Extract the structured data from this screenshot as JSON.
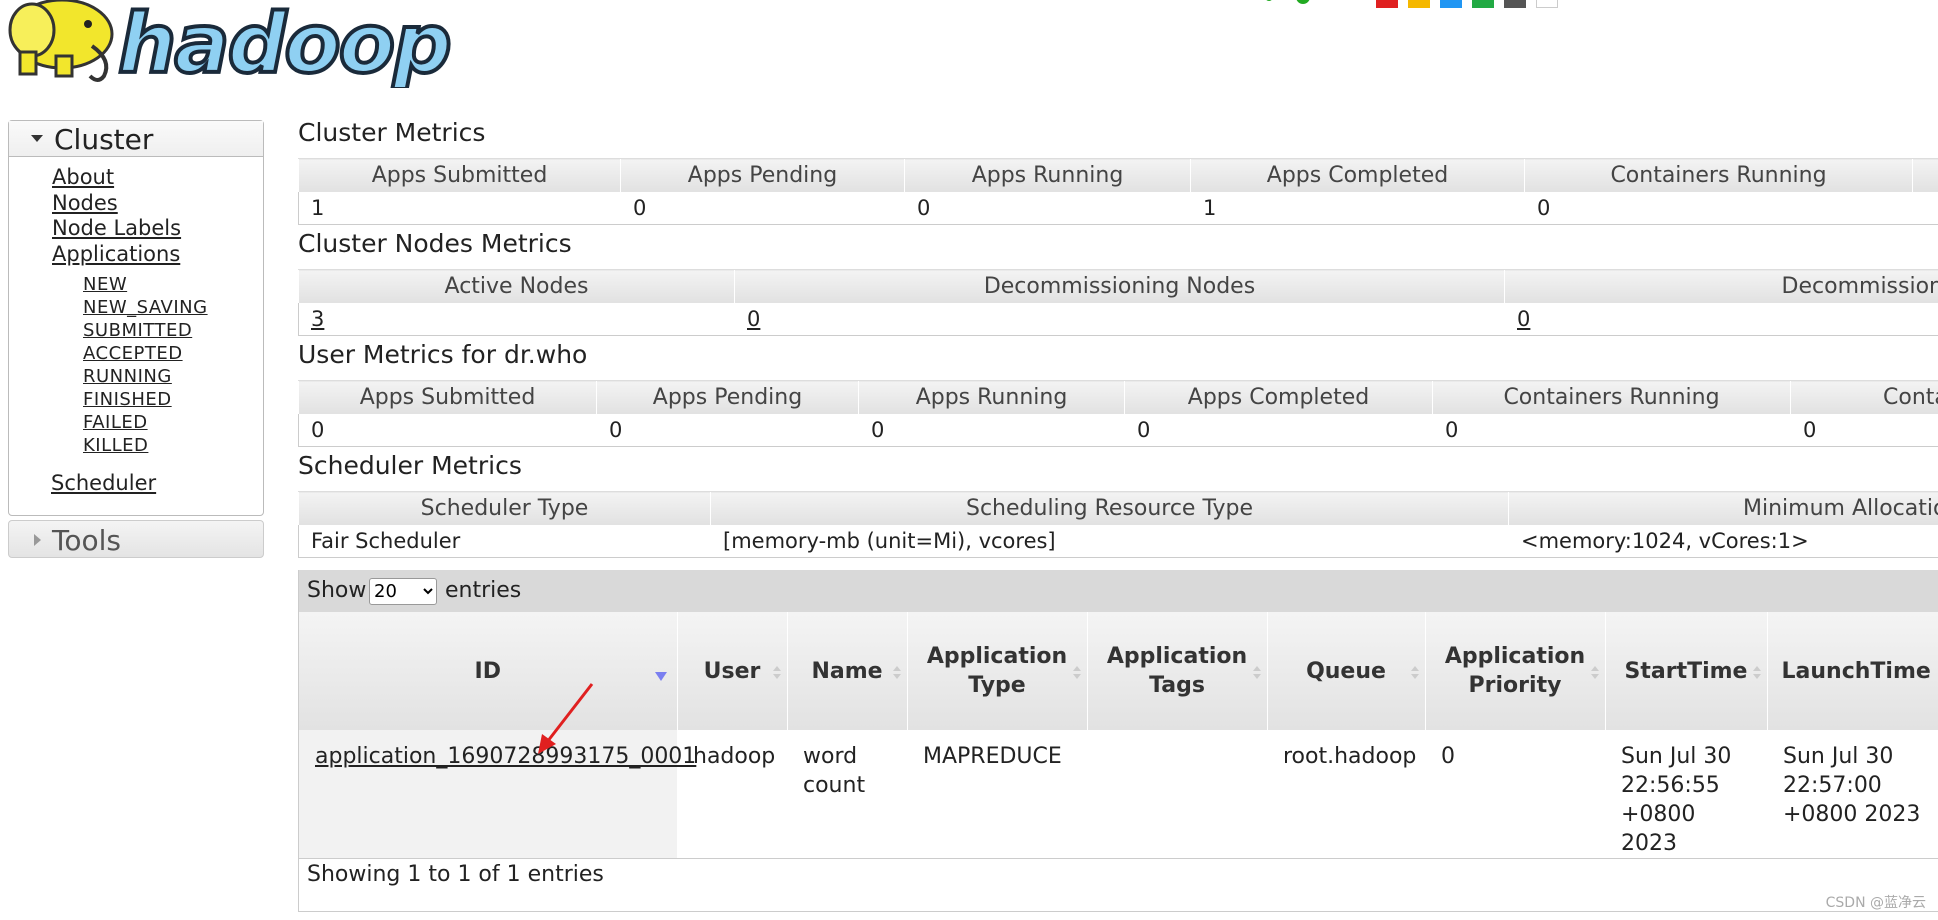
{
  "header": {
    "logo_text": "hadoop",
    "logo_alt": "hadoop",
    "status_dot_colors": [
      "#22aa22",
      "#22aa22",
      "#e02020",
      "#f5b800",
      "#2196f3",
      "#22aa44",
      "#555555",
      "#ffffff"
    ]
  },
  "nav": {
    "cluster_title": "Cluster",
    "links": [
      "About",
      "Nodes",
      "Node Labels",
      "Applications"
    ],
    "app_states": [
      "NEW",
      "NEW_SAVING",
      "SUBMITTED",
      "ACCEPTED",
      "RUNNING",
      "FINISHED",
      "FAILED",
      "KILLED"
    ],
    "scheduler": "Scheduler",
    "tools_title": "Tools"
  },
  "cluster_metrics": {
    "title": "Cluster Metrics",
    "headers": [
      "Apps Submitted",
      "Apps Pending",
      "Apps Running",
      "Apps Completed",
      "Containers Running",
      ""
    ],
    "values": [
      "1",
      "0",
      "0",
      "1",
      "0",
      "<"
    ]
  },
  "nodes_metrics": {
    "title": "Cluster Nodes Metrics",
    "headers": [
      "Active Nodes",
      "Decommissioning Nodes",
      "Decommissioned"
    ],
    "values": [
      "3",
      "0",
      "0"
    ]
  },
  "user_metrics": {
    "title": "User Metrics for dr.who",
    "headers": [
      "Apps Submitted",
      "Apps Pending",
      "Apps Running",
      "Apps Completed",
      "Containers Running",
      "Contai"
    ],
    "values": [
      "0",
      "0",
      "0",
      "0",
      "0",
      "0"
    ]
  },
  "scheduler_metrics": {
    "title": "Scheduler Metrics",
    "headers": [
      "Scheduler Type",
      "Scheduling Resource Type",
      "Minimum Allocatio"
    ],
    "values": [
      "Fair Scheduler",
      "[memory-mb (unit=Mi), vcores]",
      "<memory:1024, vCores:1>"
    ]
  },
  "apps_table": {
    "show_label": "Show",
    "entries_value": "20",
    "entries_label": "entries",
    "columns": {
      "id": "ID",
      "user": "User",
      "name": "Name",
      "app_type_1": "Application",
      "app_type_2": "Type",
      "app_tags_1": "Application",
      "app_tags_2": "Tags",
      "queue": "Queue",
      "priority_1": "Application",
      "priority_2": "Priority",
      "start": "StartTime",
      "launch": "LaunchTime"
    },
    "row": {
      "id": "application_1690728993175_0001",
      "user": "hadoop",
      "name": "word count",
      "type": "MAPREDUCE",
      "tags": "",
      "queue": "root.hadoop",
      "priority": "0",
      "start_1": "Sun Jul 30",
      "start_2": "22:56:55",
      "start_3": "+0800 2023",
      "launch_1": "Sun Jul 30",
      "launch_2": "22:57:00",
      "launch_3": "+0800 2023"
    },
    "showing": "Showing 1 to 1 of 1 entries"
  },
  "watermark": "CSDN @蓝净云"
}
